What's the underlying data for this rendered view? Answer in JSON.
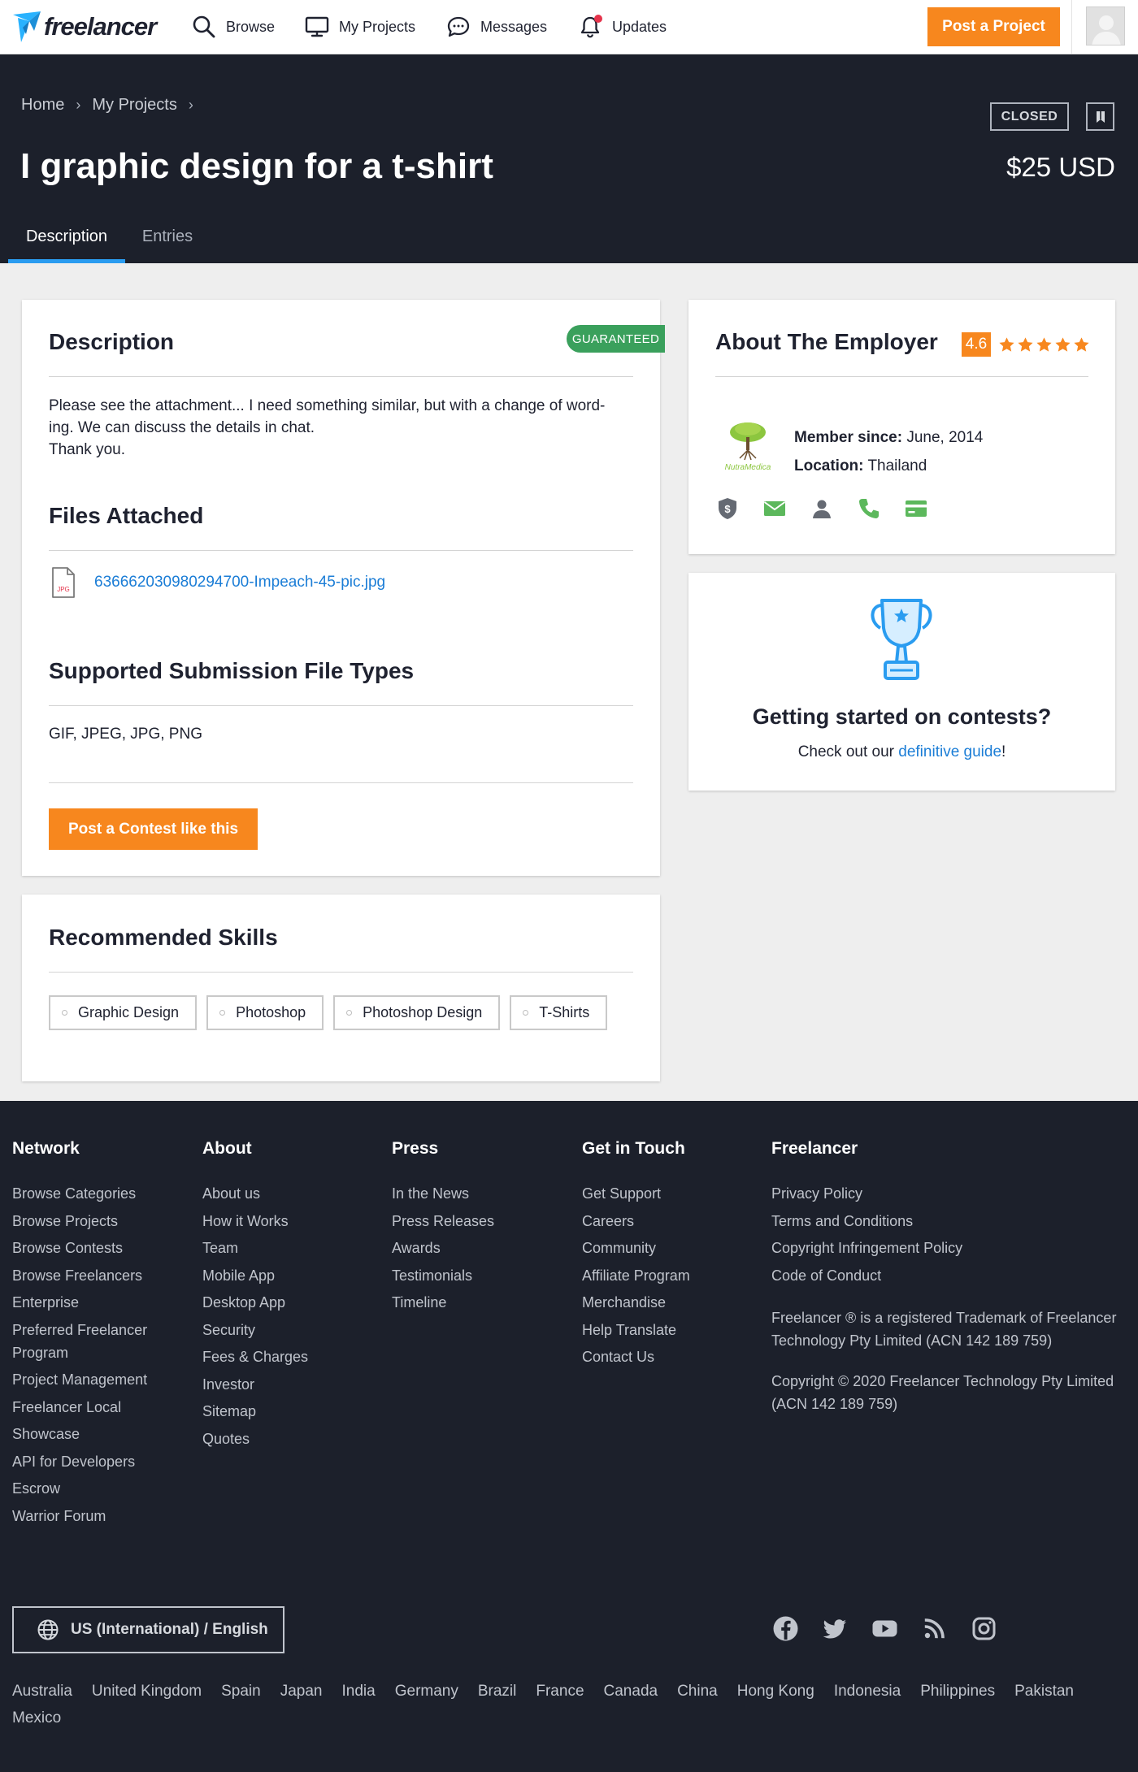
{
  "nav": {
    "logo_text": "freelancer",
    "browse": "Browse",
    "my_projects": "My Projects",
    "messages": "Messages",
    "updates": "Updates",
    "post_project": "Post a Project"
  },
  "header": {
    "breadcrumbs": [
      "Home",
      "My Projects"
    ],
    "status": "CLOSED",
    "title": "I graphic design for a t-shirt",
    "budget": "$25 USD",
    "tabs": [
      "Description",
      "Entries"
    ]
  },
  "description": {
    "heading": "Description",
    "badge": "GUARANTEED",
    "body_lines": [
      "Please see the attachment... I need something similar, but with a change of word-",
      "ing. We can discuss the details in chat.",
      "Thank you."
    ],
    "files_heading": "Files Attached",
    "file_type_label": "JPG",
    "file_name": "636662030980294700-Impeach-45-pic.jpg",
    "types_heading": "Supported Submission File Types",
    "types": "GIF, JPEG, JPG, PNG",
    "post_contest": "Post a Contest like this"
  },
  "skills": {
    "heading": "Recommended Skills",
    "items": [
      "Graphic Design",
      "Photoshop",
      "Photoshop Design",
      "T-Shirts"
    ]
  },
  "employer": {
    "heading": "About The Employer",
    "rating": "4.6",
    "stars": 5,
    "logo_text": "NutraMedica",
    "member_since_label": "Member since:",
    "member_since": "June, 2014",
    "location_label": "Location:",
    "location": "Thailand"
  },
  "contest_help": {
    "title": "Getting started on contests?",
    "sub_before": "Check out our ",
    "sub_link": "definitive guide",
    "sub_after": "!"
  },
  "footer": {
    "columns": [
      {
        "title": "Network",
        "links": [
          "Browse Categories",
          "Browse Projects",
          "Browse Contests",
          "Browse Freelancers",
          "Enterprise",
          "Preferred Freelancer Program",
          "Project Management",
          "Freelancer Local",
          "Showcase",
          "API for Developers",
          "Escrow",
          "Warrior Forum"
        ]
      },
      {
        "title": "About",
        "links": [
          "About us",
          "How it Works",
          "Team",
          "Mobile App",
          "Desktop App",
          "Security",
          "Fees & Charges",
          "Investor",
          "Sitemap",
          "Quotes"
        ]
      },
      {
        "title": "Press",
        "links": [
          "In the News",
          "Press Releases",
          "Awards",
          "Testimonials",
          "Timeline"
        ]
      },
      {
        "title": "Get in Touch",
        "links": [
          "Get Support",
          "Careers",
          "Community",
          "Affiliate Program",
          "Merchandise",
          "Help Translate",
          "Contact Us"
        ]
      },
      {
        "title": "Freelancer",
        "links": [
          "Privacy Policy",
          "Terms and Conditions",
          "Copyright Infringement Policy",
          "Code of Conduct"
        ]
      }
    ],
    "trademark": "Freelancer ® is a registered Trademark of Freelancer Technology Pty Limited (ACN 142 189 759)",
    "copyright": "Copyright © 2020 Freelancer Technology Pty Limited (ACN 142 189 759)",
    "language": "US (International) / English",
    "countries": [
      "Australia",
      "United Kingdom",
      "Spain",
      "Japan",
      "India",
      "Germany",
      "Brazil",
      "France",
      "Canada",
      "China",
      "Hong Kong",
      "Indonesia",
      "Philippines",
      "Pakistan",
      "Mexico"
    ]
  },
  "colors": {
    "accent_orange": "#f7871e",
    "link_blue": "#1b7dd6",
    "dark_bg": "#1c202b",
    "verified_green": "#5cb85c",
    "guaranteed_green": "#3aa05c"
  },
  "icons": [
    "search-icon",
    "monitor-icon",
    "chat-bubble-icon",
    "bell-icon",
    "bookmark-icon",
    "file-icon",
    "star-icon",
    "shield-dollar-icon",
    "mail-icon",
    "user-icon",
    "phone-icon",
    "credit-card-icon",
    "trophy-icon",
    "globe-icon",
    "facebook-icon",
    "twitter-icon",
    "youtube-icon",
    "rss-icon",
    "instagram-icon"
  ]
}
